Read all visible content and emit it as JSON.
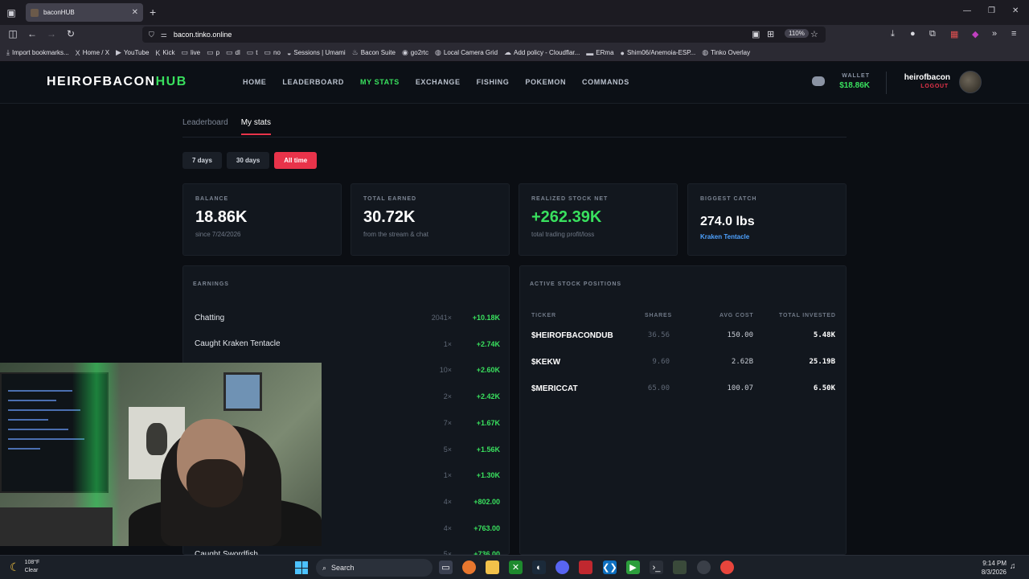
{
  "browser": {
    "tab_title": "baconHUB",
    "url_host": "bacon.tinko.online",
    "zoom": "110%",
    "bookmarks": [
      {
        "label": "Import bookmarks...",
        "icon": "import-icon"
      },
      {
        "label": "Home / X",
        "icon": "x-logo-icon"
      },
      {
        "label": "YouTube",
        "icon": "youtube-icon"
      },
      {
        "label": "Kick",
        "icon": "kick-icon"
      },
      {
        "label": "live",
        "icon": "folder-icon"
      },
      {
        "label": "p",
        "icon": "folder-icon"
      },
      {
        "label": "dl",
        "icon": "folder-icon"
      },
      {
        "label": "t",
        "icon": "folder-icon"
      },
      {
        "label": "no",
        "icon": "folder-icon"
      },
      {
        "label": "Sessions | Umami",
        "icon": "umami-icon"
      },
      {
        "label": "Bacon Suite",
        "icon": "bacon-icon"
      },
      {
        "label": "go2rtc",
        "icon": "go2rtc-icon"
      },
      {
        "label": "Local Camera Grid",
        "icon": "globe-icon"
      },
      {
        "label": "Add policy - Cloudflar...",
        "icon": "cloudflare-icon"
      },
      {
        "label": "ERma",
        "icon": "erma-icon"
      },
      {
        "label": "Shim06/Anemoia-ESP...",
        "icon": "github-icon"
      },
      {
        "label": "Tinko Overlay",
        "icon": "globe-icon"
      }
    ]
  },
  "site": {
    "logo_main": "HEIROFBACON",
    "logo_accent": "HUB",
    "nav": [
      {
        "label": "HOME",
        "active": false
      },
      {
        "label": "LEADERBOARD",
        "active": false
      },
      {
        "label": "MY STATS",
        "active": true
      },
      {
        "label": "EXCHANGE",
        "active": false
      },
      {
        "label": "FISHING",
        "active": false
      },
      {
        "label": "POKEMON",
        "active": false
      },
      {
        "label": "COMMANDS",
        "active": false
      }
    ],
    "wallet_label": "WALLET",
    "wallet_value": "$18.86K",
    "username": "heirofbacon",
    "logout": "LOGOUT"
  },
  "subtabs": [
    "Leaderboard",
    "My stats"
  ],
  "ranges": [
    "7 days",
    "30 days",
    "All time"
  ],
  "cards": {
    "balance": {
      "label": "BALANCE",
      "value": "18.86K",
      "sub": "since 7/24/2026"
    },
    "earned": {
      "label": "TOTAL EARNED",
      "value": "30.72K",
      "sub": "from the stream & chat"
    },
    "stock": {
      "label": "REALIZED STOCK NET",
      "value": "+262.39K",
      "sub": "total trading profit/loss"
    },
    "catch": {
      "label": "BIGGEST CATCH",
      "value": "274.0 lbs",
      "sub": "Kraken Tentacle"
    }
  },
  "earnings": {
    "title": "EARNINGS",
    "rows": [
      {
        "name": "Chatting",
        "count": "2041×",
        "amount": "+10.18K"
      },
      {
        "name": "Caught Kraken Tentacle",
        "count": "1×",
        "amount": "+2.74K"
      },
      {
        "name": "",
        "count": "10×",
        "amount": "+2.60K"
      },
      {
        "name": "",
        "count": "2×",
        "amount": "+2.42K"
      },
      {
        "name": "",
        "count": "7×",
        "amount": "+1.67K"
      },
      {
        "name": "",
        "count": "5×",
        "amount": "+1.56K"
      },
      {
        "name": "",
        "count": "1×",
        "amount": "+1.30K"
      },
      {
        "name": "",
        "count": "4×",
        "amount": "+802.00"
      },
      {
        "name": "",
        "count": "4×",
        "amount": "+763.00"
      },
      {
        "name": "Caught Swordfish",
        "count": "5×",
        "amount": "+736.00"
      }
    ]
  },
  "stocks": {
    "title": "ACTIVE STOCK POSITIONS",
    "headers": {
      "ticker": "TICKER",
      "shares": "SHARES",
      "avg": "AVG COST",
      "total": "TOTAL INVESTED"
    },
    "rows": [
      {
        "ticker": "$HEIROFBACONDUB",
        "shares": "36.56",
        "avg": "150.00",
        "total": "5.48K"
      },
      {
        "ticker": "$KEKW",
        "shares": "9.60",
        "avg": "2.62B",
        "total": "25.19B"
      },
      {
        "ticker": "$MERICCAT",
        "shares": "65.00",
        "avg": "100.07",
        "total": "6.50K"
      }
    ]
  },
  "taskbar": {
    "temp": "108°F",
    "condition": "Clear",
    "search": "Search",
    "time": "9:14 PM",
    "date": "8/3/2026"
  },
  "colors": {
    "accent_green": "#39e05e",
    "accent_red": "#e8334a",
    "link_blue": "#4ea2ff"
  }
}
